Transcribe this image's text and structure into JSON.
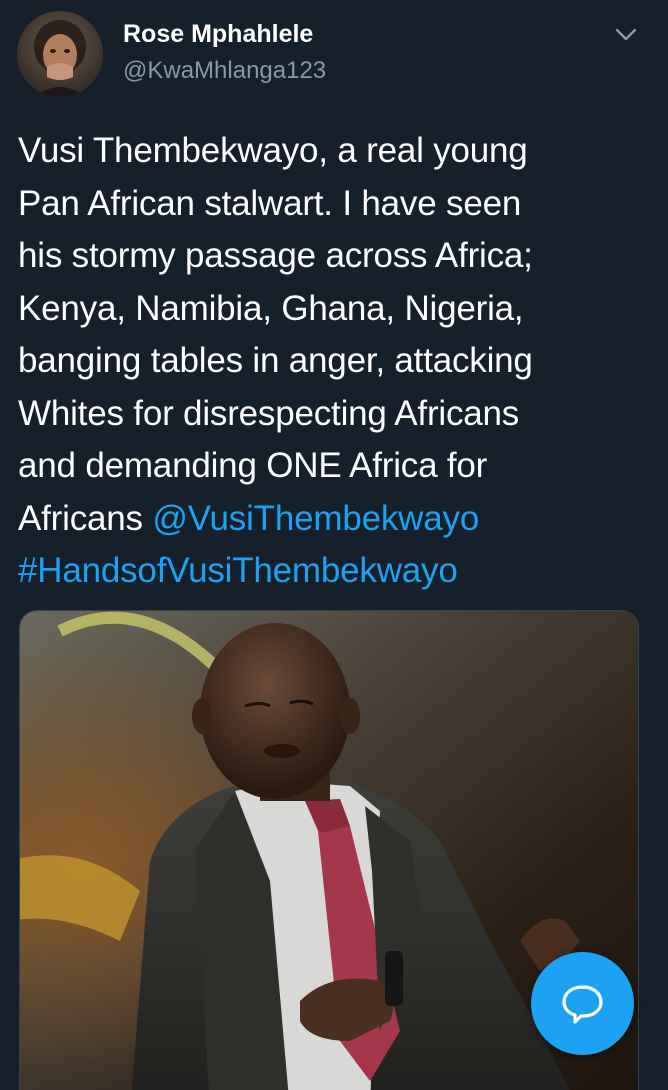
{
  "tweet": {
    "author": {
      "display_name": "Rose Mphahlele",
      "handle": "@KwaMhlanga123",
      "avatar_icon": "profile-photo"
    },
    "menu_icon": "chevron-down-icon",
    "text_lines": [
      "Vusi Thembekwayo, a real young",
      "Pan African stalwart. I have seen",
      "his stormy passage across Africa;",
      "Kenya, Namibia, Ghana, Nigeria,",
      "banging tables in anger, attacking",
      "Whites for disrespecting Africans",
      "and demanding ONE Africa for",
      "Africans "
    ],
    "mention": "@VusiThembekwayo",
    "hashtag": "#HandsofVusiThembekwayo",
    "media": {
      "kind": "photo",
      "subject_icon": "speaker-photo"
    }
  },
  "fab": {
    "icon": "reply-bubble-icon"
  },
  "colors": {
    "background": "#15202b",
    "text": "#ffffff",
    "secondary_text": "#8899a6",
    "link": "#1da1f2",
    "fab": "#1da1f2"
  }
}
